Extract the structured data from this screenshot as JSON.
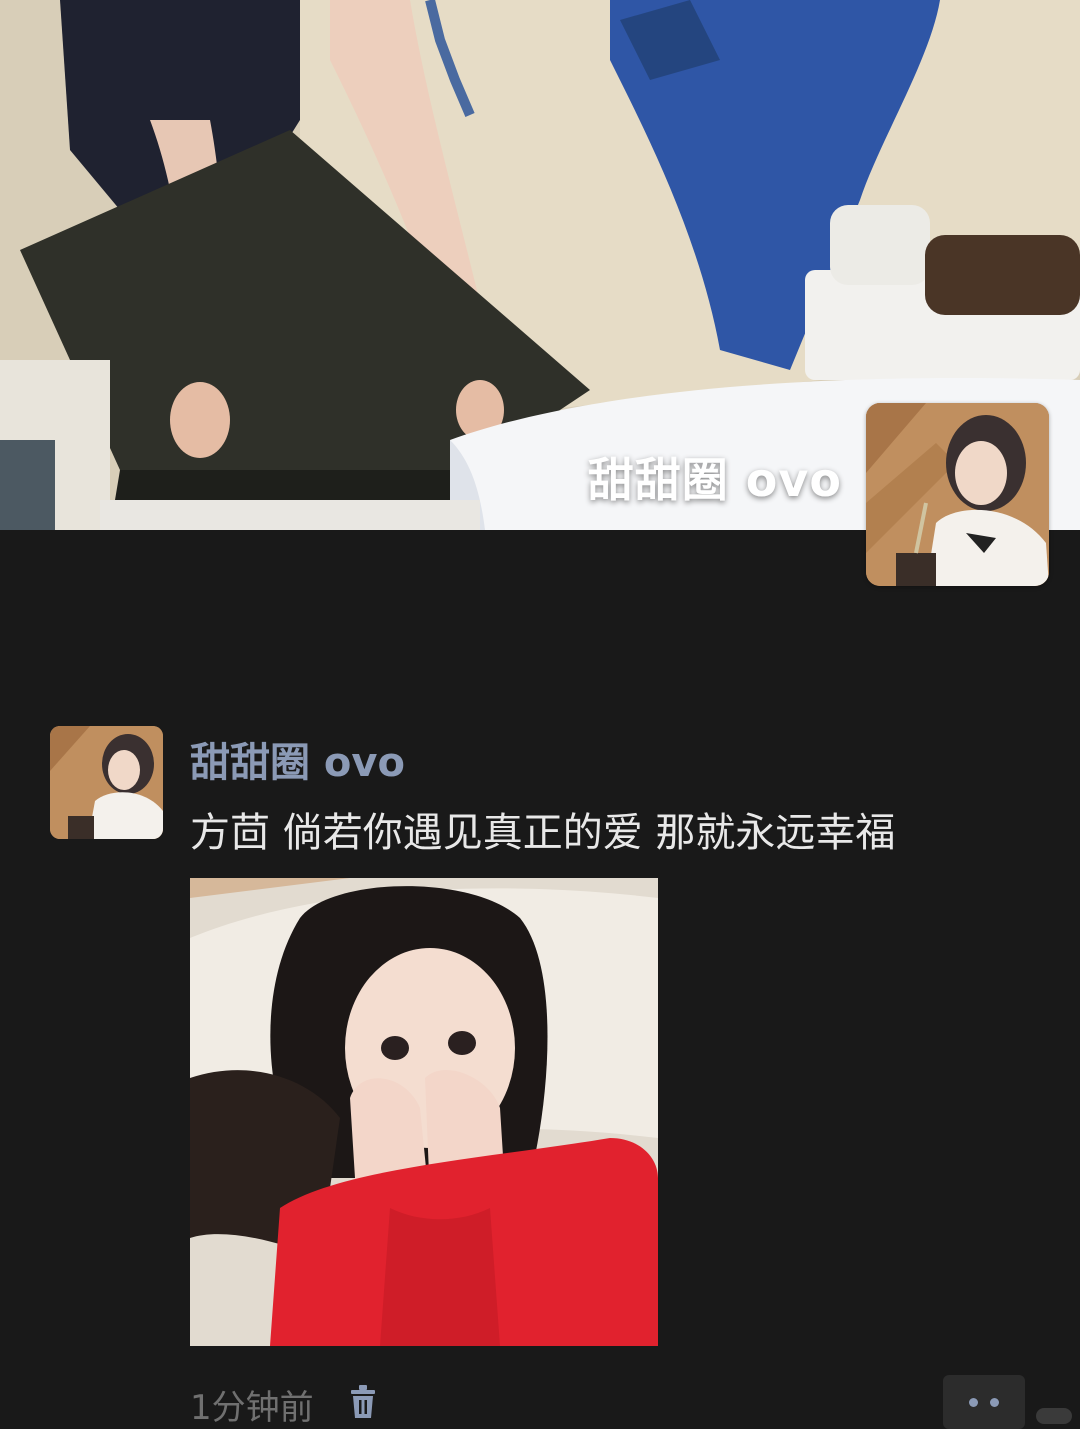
{
  "cover": {
    "username": "甜甜圈 ovo"
  },
  "post": {
    "author": "甜甜圈 ovo",
    "text": "方茴 倘若你遇见真正的爱 那就永远幸福",
    "time": "1分钟前",
    "icons": {
      "delete": "trash-icon",
      "more": "more-dots-icon"
    }
  },
  "colors": {
    "background": "#191919",
    "author_name": "#8b9ab6",
    "post_text": "#e8e8e8",
    "timestamp": "#707070"
  }
}
